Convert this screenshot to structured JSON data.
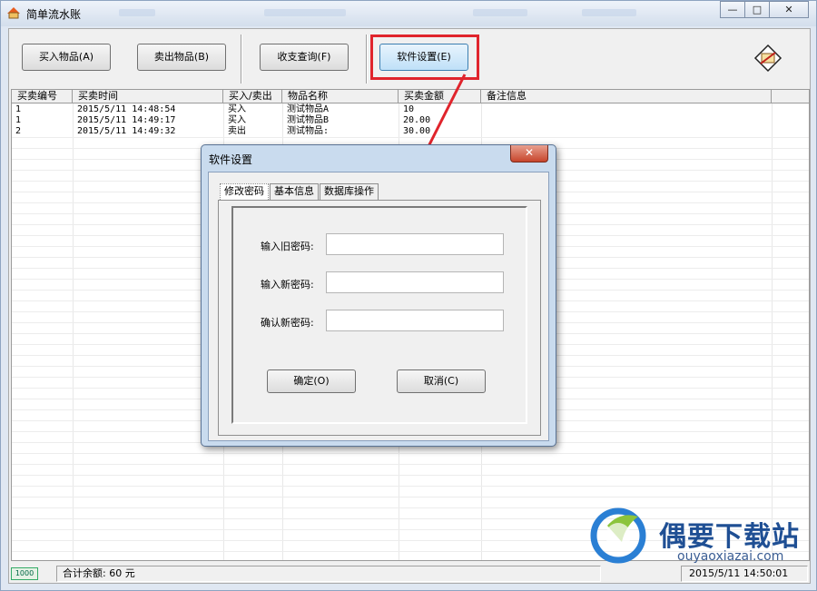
{
  "window": {
    "title": "简单流水账",
    "min_glyph": "—",
    "max_glyph": "□",
    "close_glyph": "✕"
  },
  "toolbar": {
    "buy_label": "买入物品(A)",
    "sell_label": "卖出物品(B)",
    "query_label": "收支查询(F)",
    "settings_label": "软件设置(E)"
  },
  "grid": {
    "columns": [
      "买卖编号",
      "买卖时间",
      "买入/卖出",
      "物品名称",
      "买卖金额",
      "备注信息"
    ],
    "rows": [
      [
        "1",
        "2015/5/11 14:48:54",
        "买入",
        "测试物品A",
        "10",
        ""
      ],
      [
        "1",
        "2015/5/11 14:49:17",
        "买入",
        "测试物品B",
        "20.00",
        ""
      ],
      [
        "2",
        "2015/5/11 14:49:32",
        "卖出",
        "测试物品:",
        "30.00",
        ""
      ]
    ]
  },
  "status": {
    "icon_text": "1000",
    "total": "合计余额: 60 元",
    "datetime": "2015/5/11 14:50:01"
  },
  "watermark": {
    "title": "偶要下载站",
    "url": "ouyaoxiazai.com"
  },
  "dialog": {
    "title": "软件设置",
    "close_glyph": "✕",
    "tabs": [
      "修改密码",
      "基本信息",
      "数据库操作"
    ],
    "old_password_label": "输入旧密码:",
    "new_password_label": "输入新密码:",
    "confirm_password_label": "确认新密码:",
    "old_password_value": "",
    "new_password_value": "",
    "confirm_password_value": "",
    "ok_label": "确定(O)",
    "cancel_label": "取消(C)"
  },
  "colors": {
    "highlight": "#e0242c",
    "watermark_blue": "#1f4f94"
  }
}
